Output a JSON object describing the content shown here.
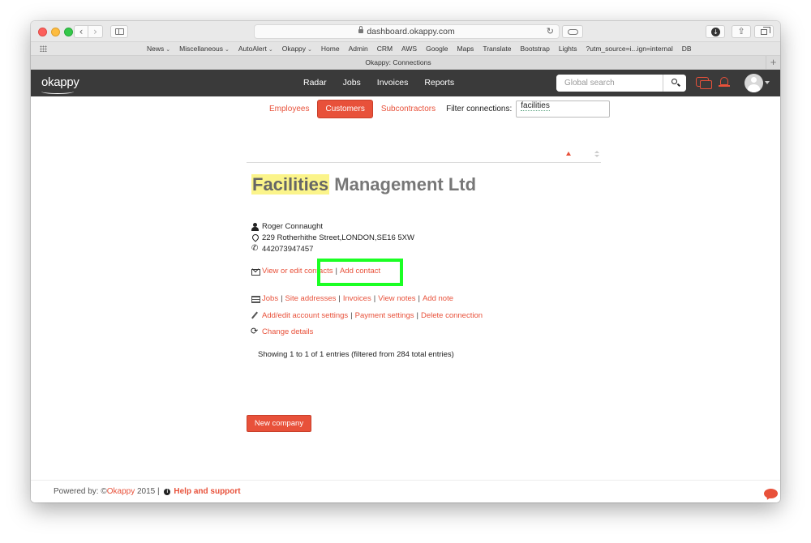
{
  "browser": {
    "url": "dashboard.okappy.com",
    "tab_title": "Okappy: Connections",
    "bookmarks": [
      {
        "label": "News",
        "dropdown": true
      },
      {
        "label": "Miscellaneous",
        "dropdown": true
      },
      {
        "label": "AutoAlert",
        "dropdown": true
      },
      {
        "label": "Okappy",
        "dropdown": true
      },
      {
        "label": "Home",
        "dropdown": false
      },
      {
        "label": "Admin",
        "dropdown": false
      },
      {
        "label": "CRM",
        "dropdown": false
      },
      {
        "label": "AWS",
        "dropdown": false
      },
      {
        "label": "Google",
        "dropdown": false
      },
      {
        "label": "Maps",
        "dropdown": false
      },
      {
        "label": "Translate",
        "dropdown": false
      },
      {
        "label": "Bootstrap",
        "dropdown": false
      },
      {
        "label": "Lights",
        "dropdown": false
      },
      {
        "label": "?utm_source=i...ign=internal",
        "dropdown": false
      },
      {
        "label": "DB",
        "dropdown": false
      }
    ]
  },
  "app": {
    "logo": "okappy",
    "nav": [
      "Radar",
      "Jobs",
      "Invoices",
      "Reports"
    ],
    "search_placeholder": "Global search"
  },
  "filters": {
    "tabs": [
      {
        "label": "Employees",
        "active": false
      },
      {
        "label": "Customers",
        "active": true
      },
      {
        "label": "Subcontractors",
        "active": false
      }
    ],
    "filter_label": "Filter connections:",
    "filter_value": "facilities"
  },
  "company": {
    "name_highlight": "Facilities",
    "name_rest": " Management Ltd",
    "contact_name": "Roger Connaught",
    "address": "229 Rotherhithe Street,LONDON,SE16 5XW",
    "phone": "442073947457",
    "contact_links": [
      "View or edit contacts",
      "Add contact"
    ],
    "record_links": [
      "Jobs",
      "Site addresses",
      "Invoices",
      "View notes",
      "Add note"
    ],
    "account_links": [
      "Add/edit account settings",
      "Payment settings",
      "Delete connection"
    ],
    "change_details": "Change details"
  },
  "table": {
    "showing": "Showing 1 to 1 of 1 entries (filtered from 284 total entries)"
  },
  "actions": {
    "new_company": "New company"
  },
  "footer": {
    "powered_by": "Powered by: © ",
    "brand": "Okappy",
    "year_sep": " 2015 | ",
    "help": "Help and support"
  },
  "colors": {
    "accent": "#e8513a",
    "navbar": "#3a3a3a",
    "highlight": "#fbf48a",
    "annotation": "#1bff24"
  }
}
